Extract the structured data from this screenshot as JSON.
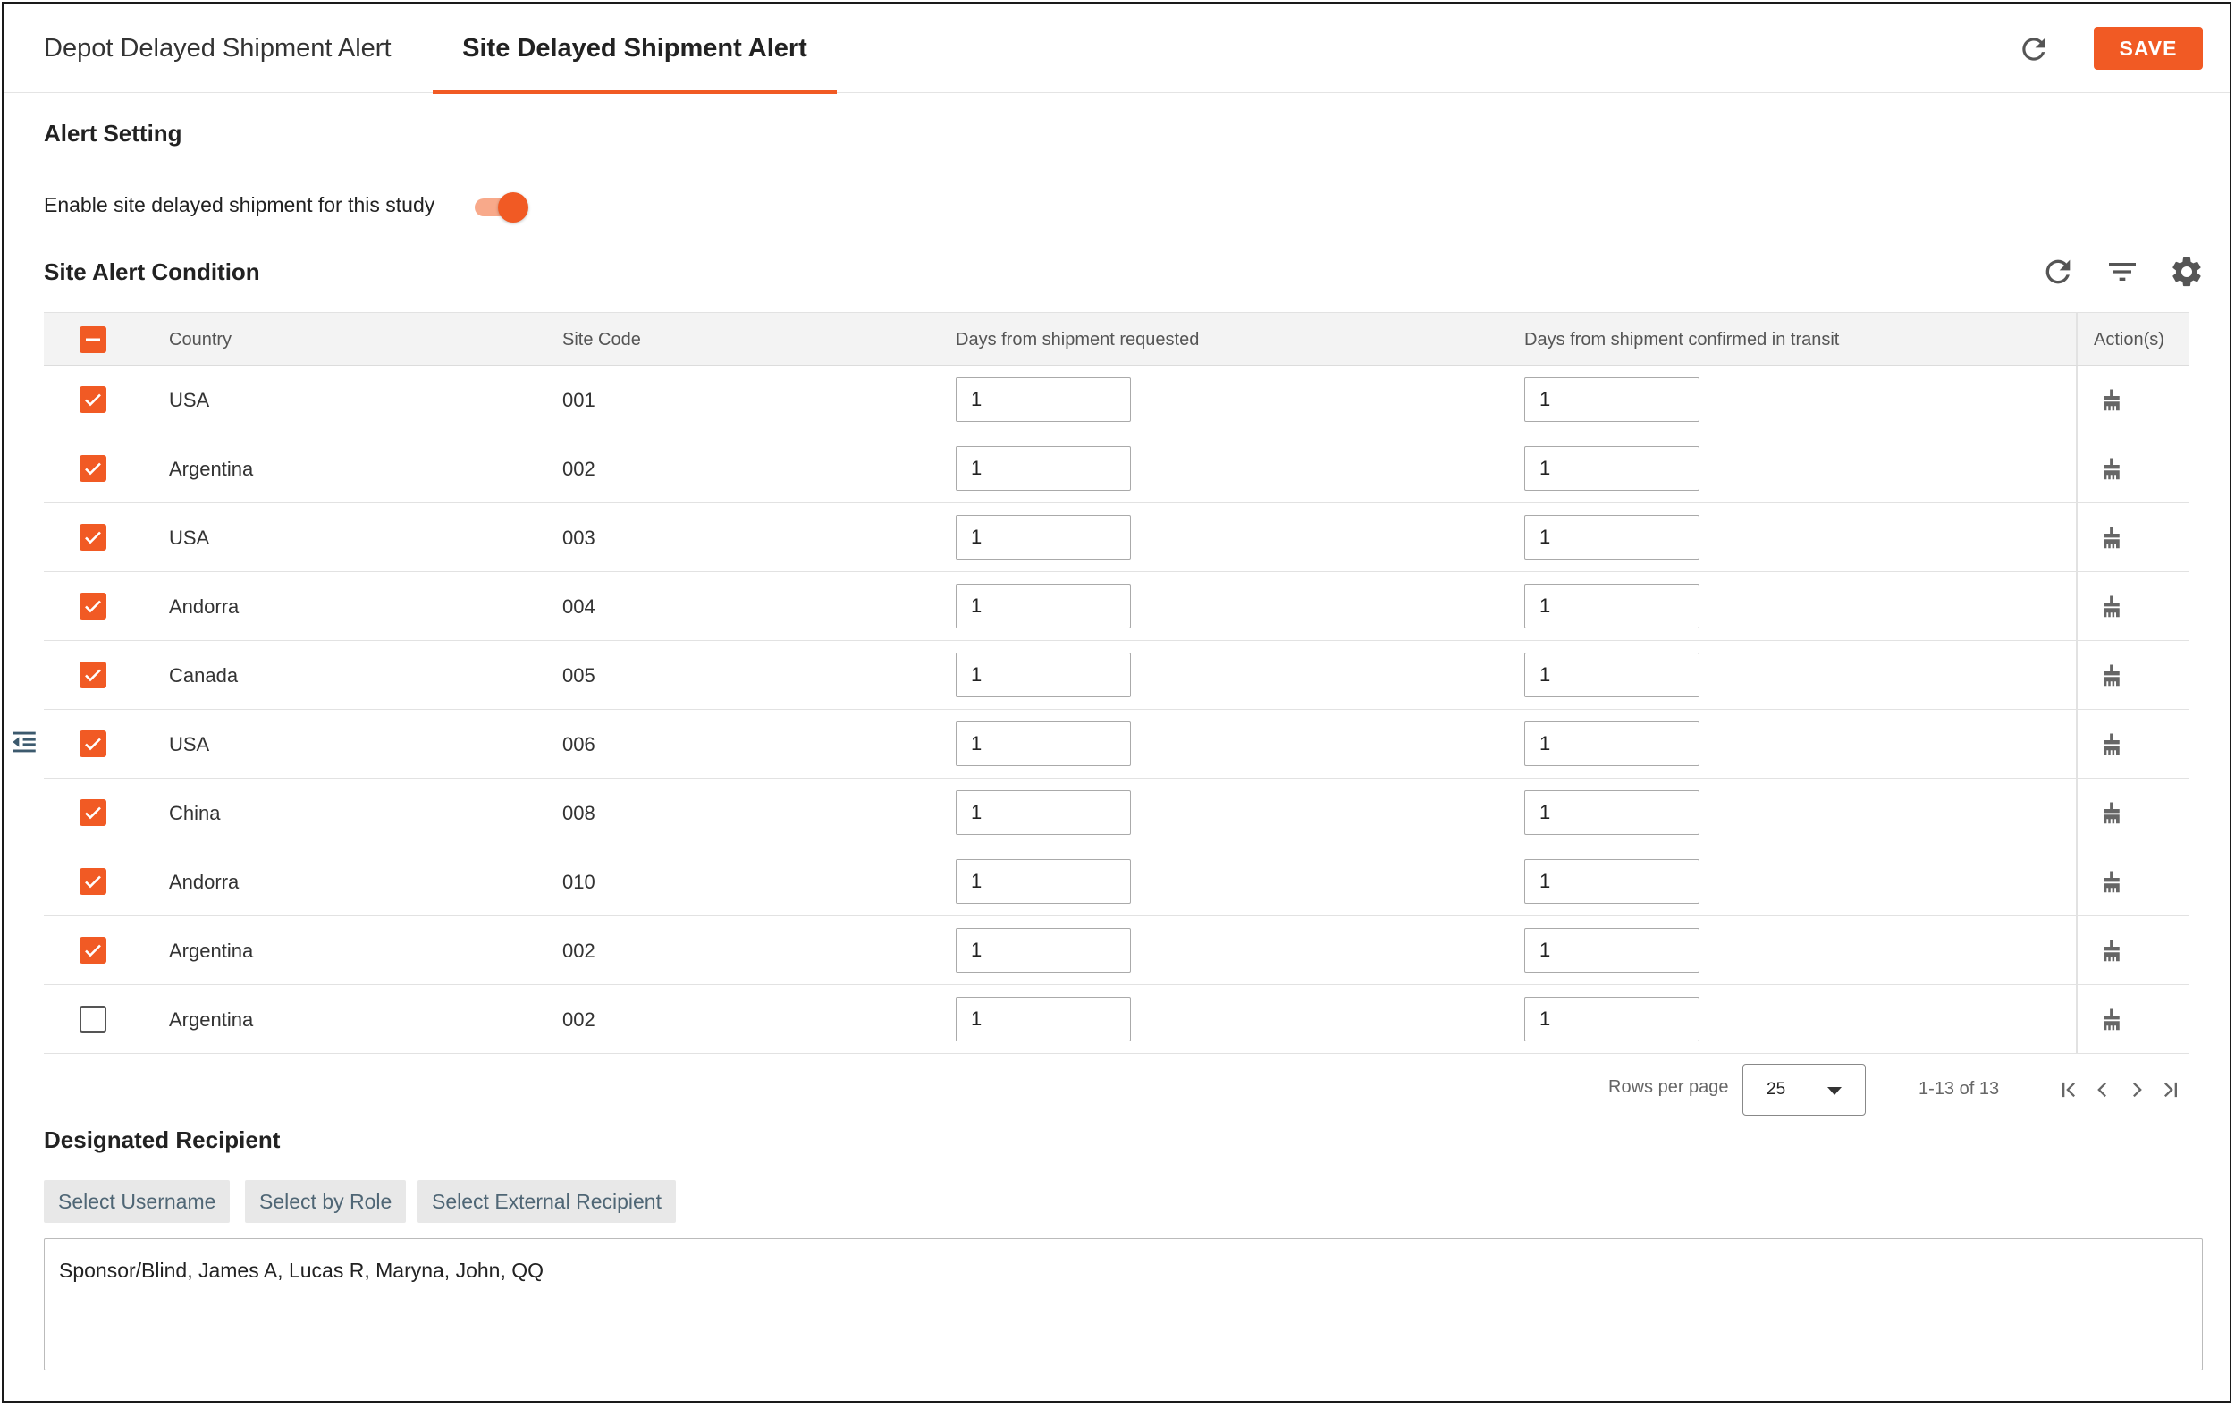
{
  "tabs": [
    {
      "label": "Depot Delayed Shipment Alert",
      "active": false
    },
    {
      "label": "Site Delayed Shipment Alert",
      "active": true
    }
  ],
  "header": {
    "save_label": "SAVE",
    "refresh_icon": "refresh-icon"
  },
  "alert_setting": {
    "title": "Alert Setting",
    "enable_label": "Enable site delayed shipment for this study",
    "enabled": true
  },
  "site_alert": {
    "title": "Site Alert Condition",
    "toolbar_icons": [
      "refresh-icon",
      "filter-icon",
      "gear-icon"
    ],
    "columns": {
      "country": "Country",
      "site_code": "Site Code",
      "days_requested": "Days from shipment requested",
      "days_transit": "Days from shipment confirmed in transit",
      "actions": "Action(s)"
    },
    "rows": [
      {
        "checked": true,
        "country": "USA",
        "site_code": "001",
        "days_requested": "1",
        "days_transit": "1"
      },
      {
        "checked": true,
        "country": "Argentina",
        "site_code": "002",
        "days_requested": "1",
        "days_transit": "1"
      },
      {
        "checked": true,
        "country": "USA",
        "site_code": "003",
        "days_requested": "1",
        "days_transit": "1"
      },
      {
        "checked": true,
        "country": "Andorra",
        "site_code": "004",
        "days_requested": "1",
        "days_transit": "1"
      },
      {
        "checked": true,
        "country": "Canada",
        "site_code": "005",
        "days_requested": "1",
        "days_transit": "1"
      },
      {
        "checked": true,
        "country": "USA",
        "site_code": "006",
        "days_requested": "1",
        "days_transit": "1"
      },
      {
        "checked": true,
        "country": "China",
        "site_code": "008",
        "days_requested": "1",
        "days_transit": "1"
      },
      {
        "checked": true,
        "country": "Andorra",
        "site_code": "010",
        "days_requested": "1",
        "days_transit": "1"
      },
      {
        "checked": true,
        "country": "Argentina",
        "site_code": "002",
        "days_requested": "1",
        "days_transit": "1"
      },
      {
        "checked": false,
        "country": "Argentina",
        "site_code": "002",
        "days_requested": "1",
        "days_transit": "1"
      }
    ]
  },
  "pagination": {
    "rows_per_page_label": "Rows per page",
    "rows_per_page": "25",
    "range": "1-13 of 13"
  },
  "recipient": {
    "title": "Designated Recipient",
    "buttons": [
      "Select Username",
      "Select by Role",
      "Select External Recipient"
    ],
    "value": "Sponsor/Blind,  James A,  Lucas R,  Maryna,  John,  QQ"
  },
  "colors": {
    "accent": "#f15a24",
    "accent_light": "#f8a98a"
  }
}
